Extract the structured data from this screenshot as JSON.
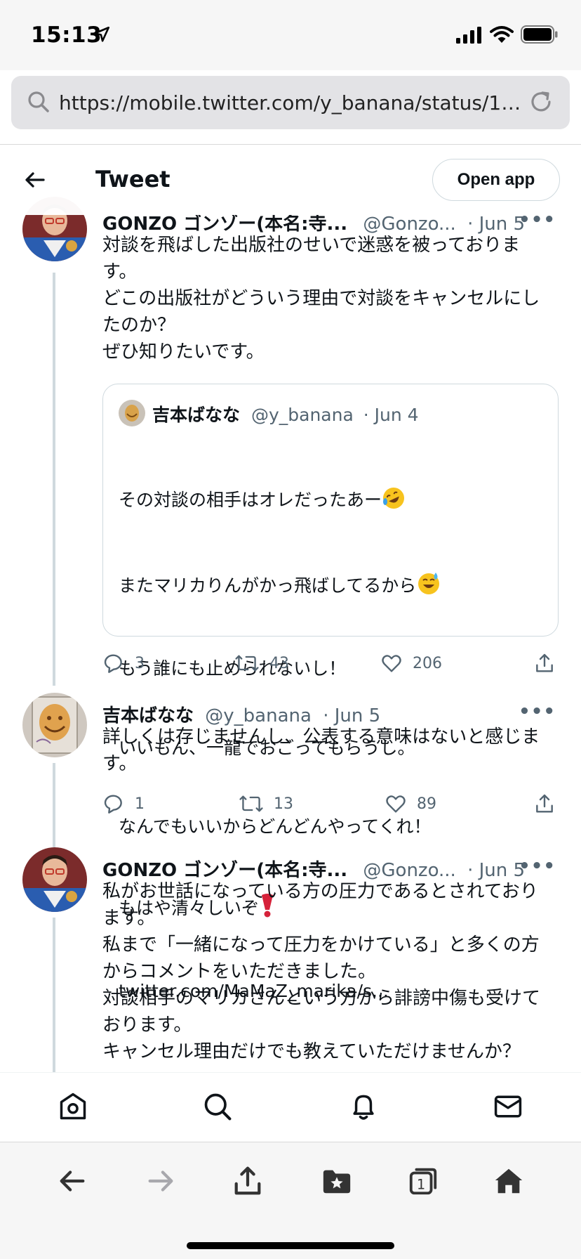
{
  "status_bar": {
    "time": "15:13"
  },
  "browser": {
    "url": "https://mobile.twitter.com/y_banana/status/15..."
  },
  "header": {
    "title": "Tweet",
    "open_app_label": "Open app"
  },
  "tweets": [
    {
      "name": "GONZO ゴンゾー(本名:寺...",
      "handle": "@Gonzo...",
      "date": "· Jun 5",
      "text": "対談を飛ばした出版社のせいで迷惑を被っておりま\nす。\nどこの出版社がどういう理由で対談をキャンセルにし\nたのか？\nぜひ知りたいです。",
      "quote": {
        "name": "吉本ばなな",
        "handle": "@y_banana",
        "date": "· Jun 4",
        "lines": [
          "その対談の相手はオレだったあー",
          "またマリカりんがかっ飛ばしてるから",
          "もう誰にも止められないし！",
          "いいもん、一龍でおごってもらうし。",
          "なんでもいいからどんどんやってくれ！",
          "もはや清々しいぞ",
          "twitter.com/MaMaZ_marika/s..."
        ]
      },
      "replies": "3",
      "retweets": "43",
      "likes": "206"
    },
    {
      "name": "吉本ばなな",
      "handle": "@y_banana",
      "date": "· Jun 5",
      "text": "詳しくは存じませんし、公表する意味はないと感じま\nす。",
      "replies": "1",
      "retweets": "13",
      "likes": "89"
    },
    {
      "name": "GONZO ゴンゾー(本名:寺...",
      "handle": "@Gonzo...",
      "date": "· Jun 5",
      "text": "私がお世話になっている方の圧力であるとされており\nます。\n私まで「一緒になって圧力をかけている」と多くの方\nからコメントをいただきました。\n対談相手のマリカさんという方から誹謗中傷も受けて\nおります。\nキャンセル理由だけでも教えていただけませんか？"
    }
  ],
  "more_label": "•••",
  "colors": {
    "accent": "#1d9bf0",
    "text": "#0f1419",
    "secondary": "#536471",
    "border": "#cfd9de"
  }
}
